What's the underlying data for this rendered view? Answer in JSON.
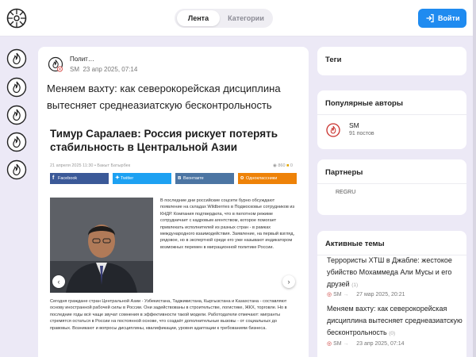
{
  "header": {
    "tabs": [
      {
        "label": "Лента",
        "active": true
      },
      {
        "label": "Категории",
        "active": false
      }
    ],
    "login_label": "Войти",
    "accent": "#1f8bf0"
  },
  "rail": {
    "icons": [
      "flame-icon",
      "flame-icon",
      "flame-icon",
      "flame-icon",
      "flame-icon"
    ]
  },
  "post": {
    "feed_name": "Полит…",
    "author": "SM",
    "date": "23 апр 2025, 07:14",
    "title": "Меняем вахту: как северокорейская дисциплина вытесняет среднеазиатскую бесконтрольность",
    "embed": {
      "title": "Тимур Саралаев: Россия рискует потерять стабильность в Центральной Азии",
      "meta": "21 апреля 2025 11:30 • Бакыт Батырбек",
      "views": "860",
      "comments": "0",
      "share": {
        "facebook": "Facebook",
        "twitter": "Twitter",
        "vk": "Вконтакте",
        "ok": "Одноклассники"
      },
      "paragraph1": "В последние дни российские соцсети бурно обсуждают появление на складах Wildberries в Подмосковье сотрудников из КНДР. Компания подтвердила, что в пилотном режиме сотрудничает с кадровым агентством, которое помогает привлекать исполнителей из разных стран - в рамках международного взаимодействия. Заявление, на первый взгляд, рядовое, но в экспертной среде его уже называют индикатором возможных перемен в миграционной политике России.",
      "paragraph2": "Сегодня граждане стран Центральной Азии - Узбекистана, Таджикистана, Кыргызстана и Казахстана - составляют основу иностранной рабочей силы в России. Они задействованы в строительстве, логистике, ЖКХ, торговле. Но в последние годы всё чаще звучат сомнения в эффективности такой модели. Работодатели отмечают: мигранты стремятся остаться в России на постоянной основе, что создаёт дополнительные вызовы - от социальных до правовых. Возникают и вопросы дисциплины, квалификации, уровня адаптации к требованиям бизнеса."
    }
  },
  "sidebar": {
    "tags_title": "Теги",
    "popular_title": "Популярные авторы",
    "popular_author": {
      "name": "SM",
      "posts": "91 постов"
    },
    "partners_title": "Партнеры",
    "partner": "REGRU",
    "active_title": "Активные темы",
    "topics": [
      {
        "title": "Террористы ХТШ в Джабле: жестокое убийство Мохаммеда Али Мусы и его друзей",
        "count": "(1)",
        "author": "SM",
        "date": "27 мар 2025, 20:21"
      },
      {
        "title": "Меняем вахту: как северокорейская дисциплина вытесняет среднеазиатскую бесконтрольность",
        "count": "(0)",
        "author": "SM",
        "date": "23 апр 2025, 07:14"
      }
    ]
  }
}
